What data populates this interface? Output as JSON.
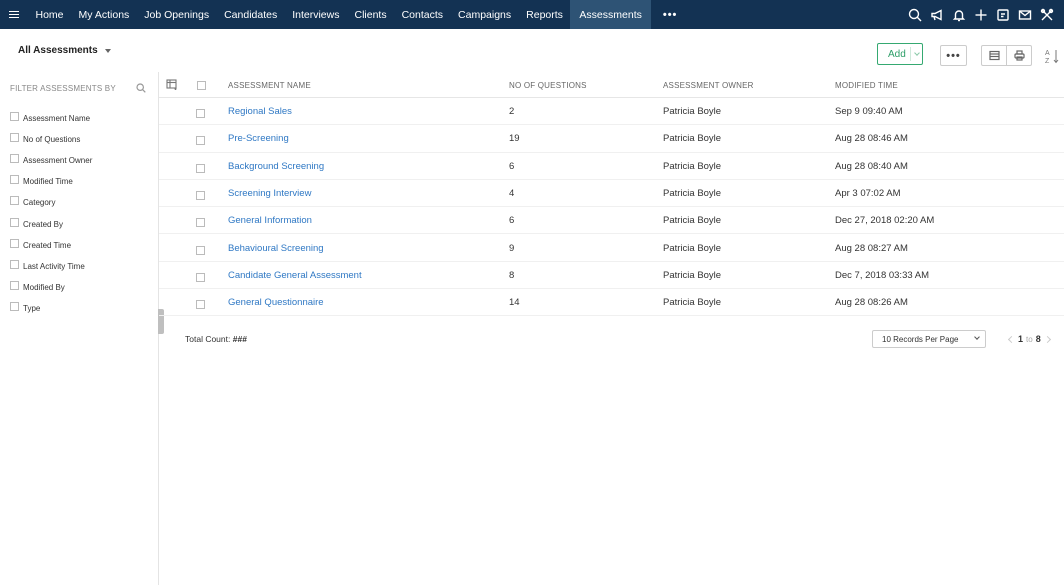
{
  "nav": {
    "items": [
      "Home",
      "My Actions",
      "Job Openings",
      "Candidates",
      "Interviews",
      "Clients",
      "Contacts",
      "Campaigns",
      "Reports",
      "Assessments"
    ],
    "active": "Assessments",
    "more_label": "•••",
    "icons": [
      "search-icon",
      "megaphone-icon",
      "bell-icon",
      "plus-icon",
      "calendar-note-icon",
      "mail-icon",
      "tools-icon"
    ],
    "bg_color": "#133253",
    "active_color": "#2e5375"
  },
  "toolbar": {
    "view_label": "All Assessments",
    "add_label": "Add",
    "more_label": "•••",
    "accent_color": "#35a971"
  },
  "sidebar": {
    "heading": "FILTER ASSESSMENTS BY",
    "filters": [
      "Assessment Name",
      "No of Questions",
      "Assessment Owner",
      "Modified Time",
      "Category",
      "Created By",
      "Created Time",
      "Last Activity Time",
      "Modified By",
      "Type"
    ]
  },
  "table": {
    "columns": {
      "name": "ASSESSMENT NAME",
      "questions": "NO OF QUESTIONS",
      "owner": "ASSESSMENT OWNER",
      "modified": "MODIFIED TIME"
    },
    "rows": [
      {
        "name": "Regional Sales",
        "questions": "2",
        "owner": "Patricia Boyle",
        "modified": "Sep 9 09:40 AM"
      },
      {
        "name": "Pre-Screening",
        "questions": "19",
        "owner": "Patricia Boyle",
        "modified": "Aug 28 08:46 AM"
      },
      {
        "name": "Background Screening",
        "questions": "6",
        "owner": "Patricia Boyle",
        "modified": "Aug 28 08:40 AM"
      },
      {
        "name": "Screening Interview",
        "questions": "4",
        "owner": "Patricia Boyle",
        "modified": "Apr 3 07:02 AM"
      },
      {
        "name": "General Information",
        "questions": "6",
        "owner": "Patricia Boyle",
        "modified": "Dec 27, 2018 02:20 AM"
      },
      {
        "name": "Behavioural Screening",
        "questions": "9",
        "owner": "Patricia Boyle",
        "modified": "Aug 28 08:27 AM"
      },
      {
        "name": "Candidate General Assessment",
        "questions": "8",
        "owner": "Patricia Boyle",
        "modified": "Dec 7, 2018 03:33 AM"
      },
      {
        "name": "General Questionnaire",
        "questions": "14",
        "owner": "Patricia Boyle",
        "modified": "Aug 28 08:26 AM"
      }
    ],
    "link_color": "#2f78c4"
  },
  "footer": {
    "total_label": "Total Count:",
    "total_value": "###",
    "per_page": "10 Records Per Page",
    "page_from": "1",
    "page_to_label": "to",
    "page_to": "8"
  }
}
